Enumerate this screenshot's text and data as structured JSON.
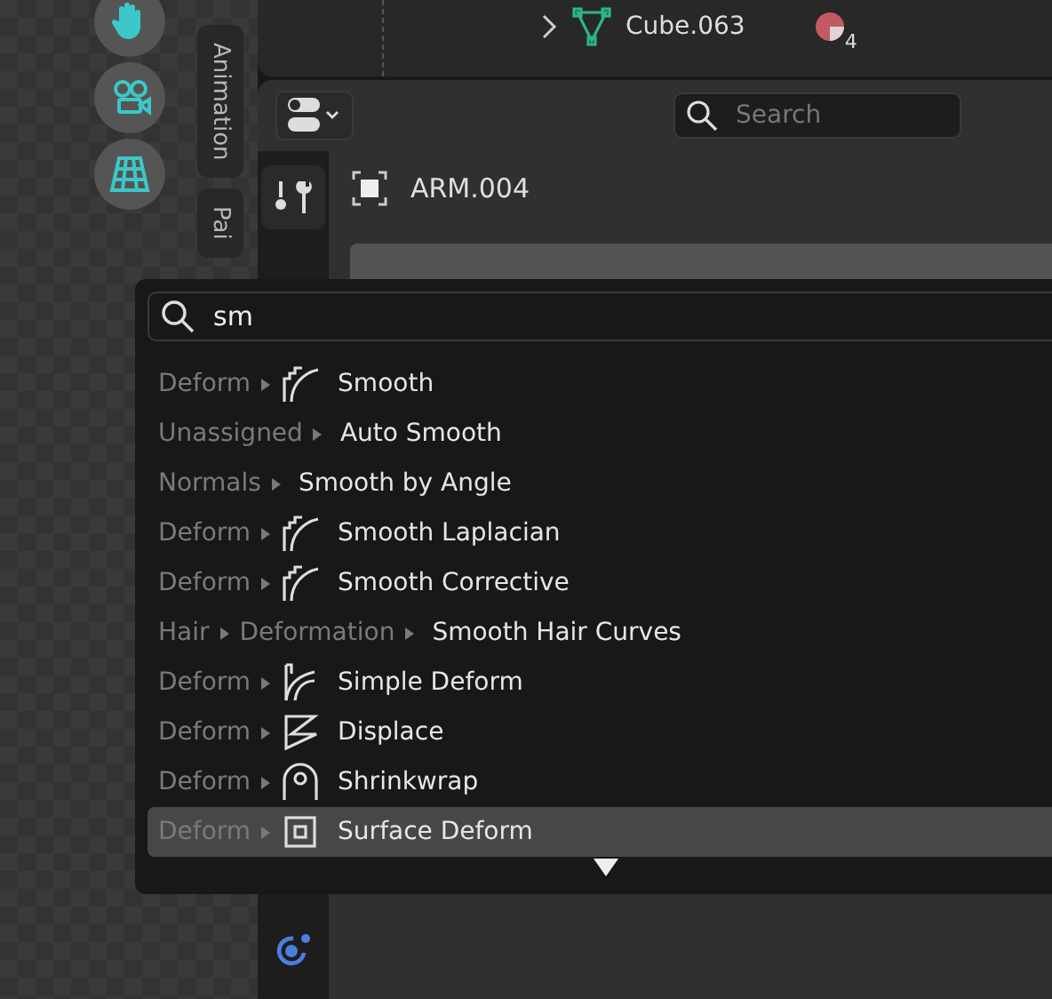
{
  "viewport": {
    "side_tabs": [
      {
        "label": "Animation",
        "selected": false
      },
      {
        "label": "Pai",
        "selected": false
      }
    ]
  },
  "outliner": {
    "row": {
      "label": "Cube.063",
      "expanded": false,
      "material_count": "4"
    }
  },
  "properties": {
    "search": {
      "placeholder": "Search"
    },
    "object_name": "ARM.004"
  },
  "menu": {
    "search": {
      "value": "sm"
    },
    "items": [
      {
        "path": [
          "Deform"
        ],
        "kind": "smooth",
        "label": "Smooth",
        "selected": false
      },
      {
        "path": [
          "Unassigned"
        ],
        "kind": "plain",
        "label": "Auto Smooth",
        "selected": false
      },
      {
        "path": [
          "Normals"
        ],
        "kind": "plain",
        "label": "Smooth by Angle",
        "selected": false
      },
      {
        "path": [
          "Deform"
        ],
        "kind": "smooth",
        "label": "Smooth Laplacian",
        "selected": false
      },
      {
        "path": [
          "Deform"
        ],
        "kind": "smooth",
        "label": "Smooth Corrective",
        "selected": false
      },
      {
        "path": [
          "Hair",
          "Deformation"
        ],
        "kind": "plain",
        "label": "Smooth Hair Curves",
        "selected": false
      },
      {
        "path": [
          "Deform"
        ],
        "kind": "bend",
        "label": "Simple Deform",
        "selected": false
      },
      {
        "path": [
          "Deform"
        ],
        "kind": "displace",
        "label": "Displace",
        "selected": false
      },
      {
        "path": [
          "Deform"
        ],
        "kind": "shrinkwrap",
        "label": "Shrinkwrap",
        "selected": false
      },
      {
        "path": [
          "Deform"
        ],
        "kind": "surface",
        "label": "Surface Deform",
        "selected": true
      }
    ]
  }
}
